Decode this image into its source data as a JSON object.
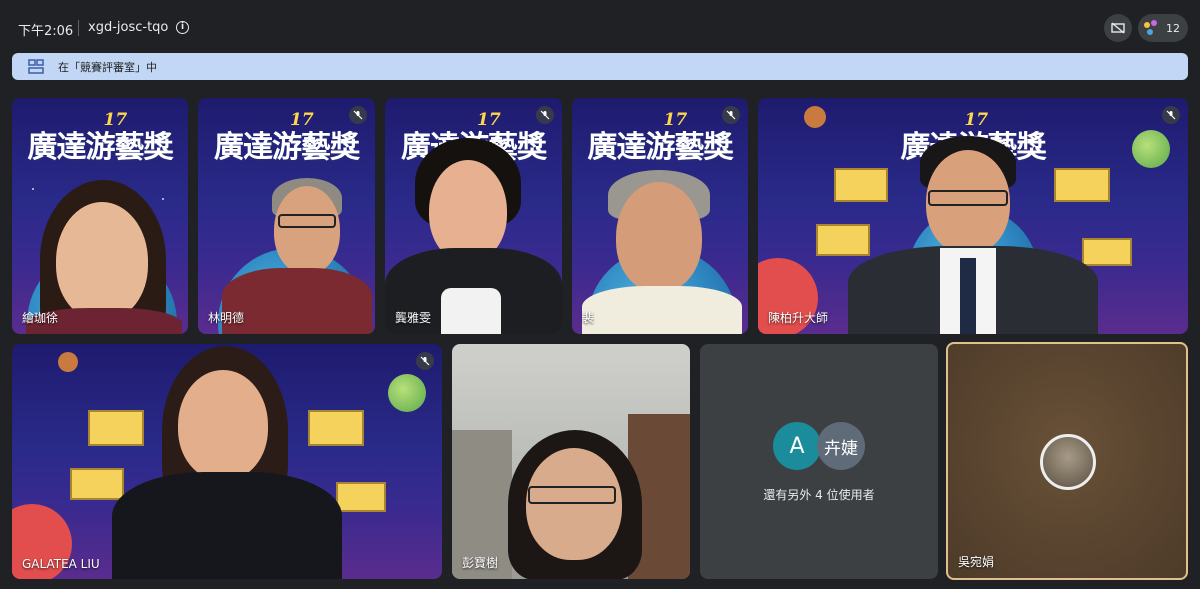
{
  "header": {
    "time": "下午2:06",
    "meeting_code": "xgd-josc-tqo",
    "people_count": "12"
  },
  "banner": {
    "text": "在「競賽評審室」中"
  },
  "poster": {
    "edition": "17",
    "title": "廣達游藝獎"
  },
  "tiles": [
    {
      "name": "繪珈徐",
      "muted": false
    },
    {
      "name": "林明德",
      "muted": true
    },
    {
      "name": "龔雅雯",
      "muted": true
    },
    {
      "name": "裴",
      "muted": true
    },
    {
      "name": "陳柏升大師",
      "muted": true
    },
    {
      "name": "GALATEA LIU",
      "muted": true
    },
    {
      "name": "彭寶樹",
      "muted": false
    },
    {
      "name": "吳宛娟",
      "muted": false
    }
  ],
  "others": {
    "avatar_a_letter": "A",
    "avatar_b_name": "卉婕",
    "text": "還有另外 4 位使用者"
  },
  "colors": {
    "background": "#202124",
    "banner": "#c2d7f5",
    "avatar_a": "#1a8c9b",
    "avatar_b": "#5f6b78",
    "active_speaker_border": "#e2c08d"
  }
}
